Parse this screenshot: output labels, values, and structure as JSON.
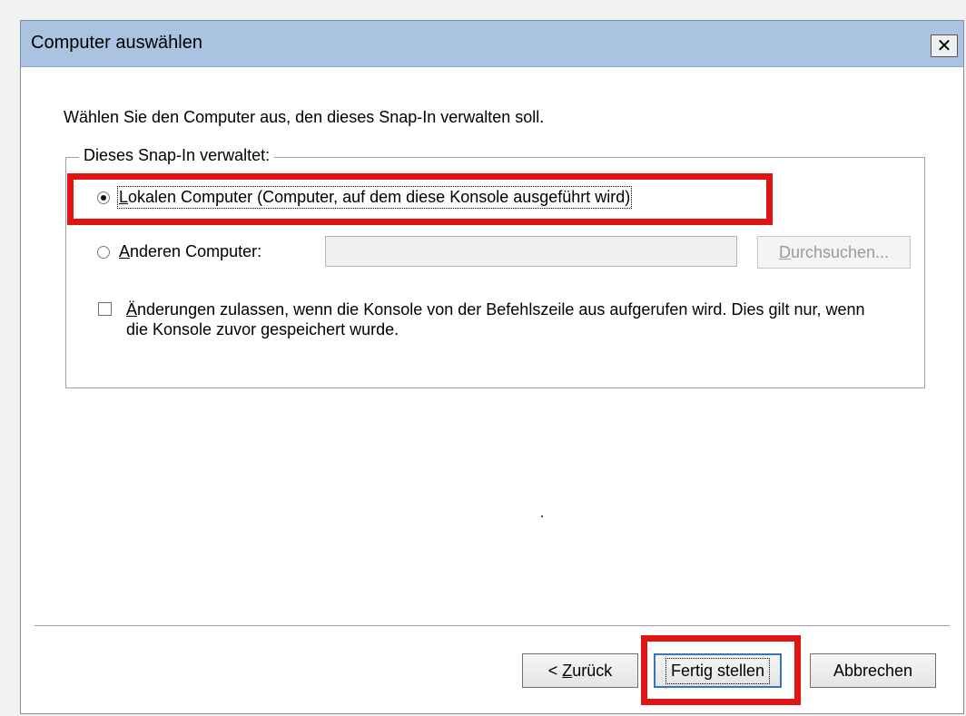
{
  "window": {
    "title": "Computer auswählen",
    "close_label": "✕"
  },
  "instruction": "Wählen Sie den Computer aus, den dieses Snap-In verwalten soll.",
  "group": {
    "legend": "Dieses Snap-In verwaltet:",
    "local_option": {
      "accesskey": "L",
      "rest": "okalen Computer (Computer, auf dem diese Konsole ausgeführt wird)",
      "checked": true
    },
    "other_option": {
      "accesskey": "A",
      "rest": "nderen Computer:",
      "checked": false,
      "input_value": ""
    },
    "browse_button": {
      "accesskey": "D",
      "rest": "urchsuchen...",
      "enabled": false
    },
    "allow_changes": {
      "accesskey": "Ä",
      "rest": "nderungen zulassen, wenn die Konsole von der Befehlszeile aus aufgerufen wird. Dies gilt nur, wenn die Konsole zuvor gespeichert wurde.",
      "checked": false
    }
  },
  "buttons": {
    "back": {
      "prefix": "< ",
      "accesskey": "Z",
      "rest": "urück"
    },
    "finish": "Fertig stellen",
    "cancel": "Abbrechen"
  },
  "colors": {
    "highlight": "#e11414",
    "titlebar": "#a9c3e1",
    "focus_border": "#3a73b8"
  }
}
